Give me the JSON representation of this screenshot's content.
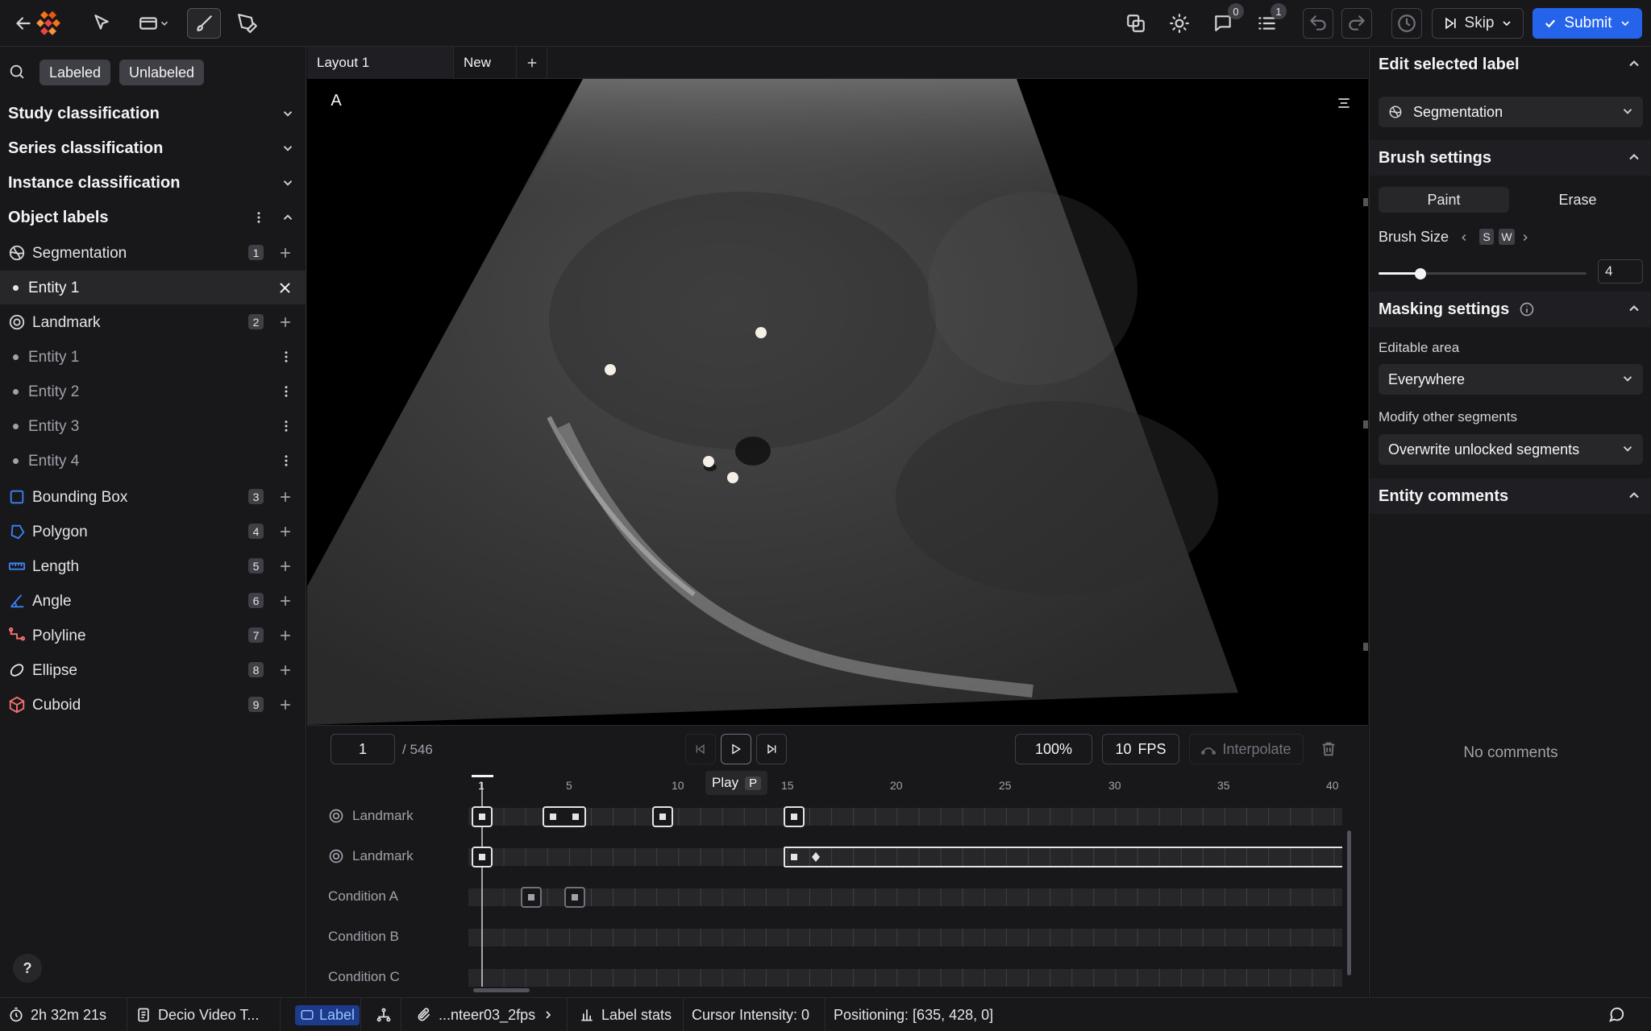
{
  "topbar": {
    "comments_count": "0",
    "tasks_count": "1",
    "skip_label": "Skip",
    "submit_label": "Submit"
  },
  "left": {
    "filters": {
      "labeled": "Labeled",
      "unlabeled": "Unlabeled"
    },
    "sections": {
      "study": "Study classification",
      "series": "Series classification",
      "instance": "Instance classification",
      "object": "Object labels"
    },
    "segmentation": {
      "label": "Segmentation",
      "count": "1",
      "entity": "Entity 1"
    },
    "landmark": {
      "label": "Landmark",
      "count": "2",
      "entities": [
        "Entity 1",
        "Entity 2",
        "Entity 3",
        "Entity 4"
      ]
    },
    "tools": [
      {
        "label": "Bounding Box",
        "count": "3",
        "color": "#3b82f6"
      },
      {
        "label": "Polygon",
        "count": "4",
        "color": "#3b82f6"
      },
      {
        "label": "Length",
        "count": "5",
        "color": "#3b82f6"
      },
      {
        "label": "Angle",
        "count": "6",
        "color": "#3b82f6"
      },
      {
        "label": "Polyline",
        "count": "7",
        "color": "#f87171"
      },
      {
        "label": "Ellipse",
        "count": "8",
        "color": "#e4e4e7"
      },
      {
        "label": "Cuboid",
        "count": "9",
        "color": "#f87171"
      }
    ],
    "help": "?"
  },
  "viewer": {
    "tabs": [
      "Layout 1",
      "New"
    ],
    "viewport_label": "A"
  },
  "timeline": {
    "frame": "1",
    "total": "/ 546",
    "zoom": "100%",
    "fps_value": "10",
    "fps_unit": "FPS",
    "interpolate": "Interpolate",
    "tooltip": {
      "text": "Play",
      "key": "P"
    },
    "ticks": [
      "1",
      "5",
      "10",
      "15",
      "20",
      "25",
      "30",
      "35",
      "40"
    ],
    "tracks": [
      "Landmark",
      "Landmark",
      "Condition A",
      "Condition B",
      "Condition C"
    ]
  },
  "right": {
    "edit_title": "Edit selected label",
    "selected_label": "Segmentation",
    "brush_title": "Brush settings",
    "paint": "Paint",
    "erase": "Erase",
    "brush_size_label": "Brush Size",
    "key_s": "S",
    "key_w": "W",
    "brush_size_value": "4",
    "brush_size_fraction": 0.2,
    "masking_title": "Masking settings",
    "editable_area_label": "Editable area",
    "editable_area_value": "Everywhere",
    "modify_label": "Modify other segments",
    "modify_value": "Overwrite unlocked segments",
    "comments_title": "Entity comments",
    "no_comments": "No comments"
  },
  "status": {
    "time": "2h 32m 21s",
    "dataset": "Decio Video T...",
    "label": "Label",
    "file": "...nteer03_2fps",
    "label_stats": "Label stats",
    "cursor_intensity": "Cursor Intensity: 0",
    "positioning": "Positioning: [635, 428, 0]"
  },
  "colors": {
    "accent": "#2563eb",
    "panel": "#18181b",
    "border": "#2a2a2e"
  }
}
